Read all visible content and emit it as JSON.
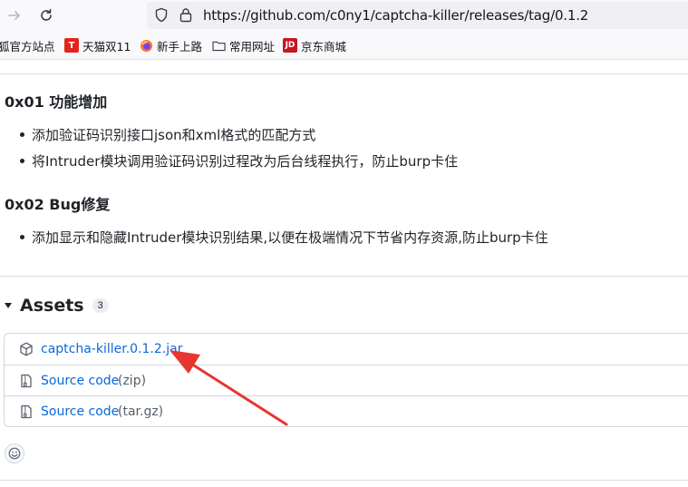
{
  "browser": {
    "url": "https://github.com/c0ny1/captcha-killer/releases/tag/0.1.2",
    "bookmarks": [
      {
        "label": "狐官方站点",
        "icon": "none"
      },
      {
        "label": "天猫双11",
        "icon": "tmall-icon"
      },
      {
        "label": "新手上路",
        "icon": "firefox-icon"
      },
      {
        "label": "常用网址",
        "icon": "folder-icon"
      },
      {
        "label": "京东商城",
        "icon": "jd-icon"
      }
    ]
  },
  "release": {
    "sections": [
      {
        "heading": "0x01 功能增加",
        "items": [
          "添加验证码识别接口json和xml格式的匹配方式",
          "将Intruder模块调用验证码识别过程改为后台线程执行，防止burp卡住"
        ]
      },
      {
        "heading": "0x02 Bug修复",
        "items": [
          "添加显示和隐藏Intruder模块识别结果,以便在极端情况下节省内存资源,防止burp卡住"
        ]
      }
    ]
  },
  "assets": {
    "title": "Assets",
    "count": "3",
    "files": [
      {
        "name": "captcha-killer.0.1.2.jar",
        "meta": "",
        "icon": "package-icon"
      },
      {
        "name": "Source code",
        "meta": "(zip)",
        "icon": "file-zip-icon"
      },
      {
        "name": "Source code",
        "meta": "(tar.gz)",
        "icon": "file-zip-icon"
      }
    ]
  },
  "colors": {
    "link": "#0969da",
    "annotation_arrow": "#e8352e",
    "border": "#d0d7de"
  }
}
